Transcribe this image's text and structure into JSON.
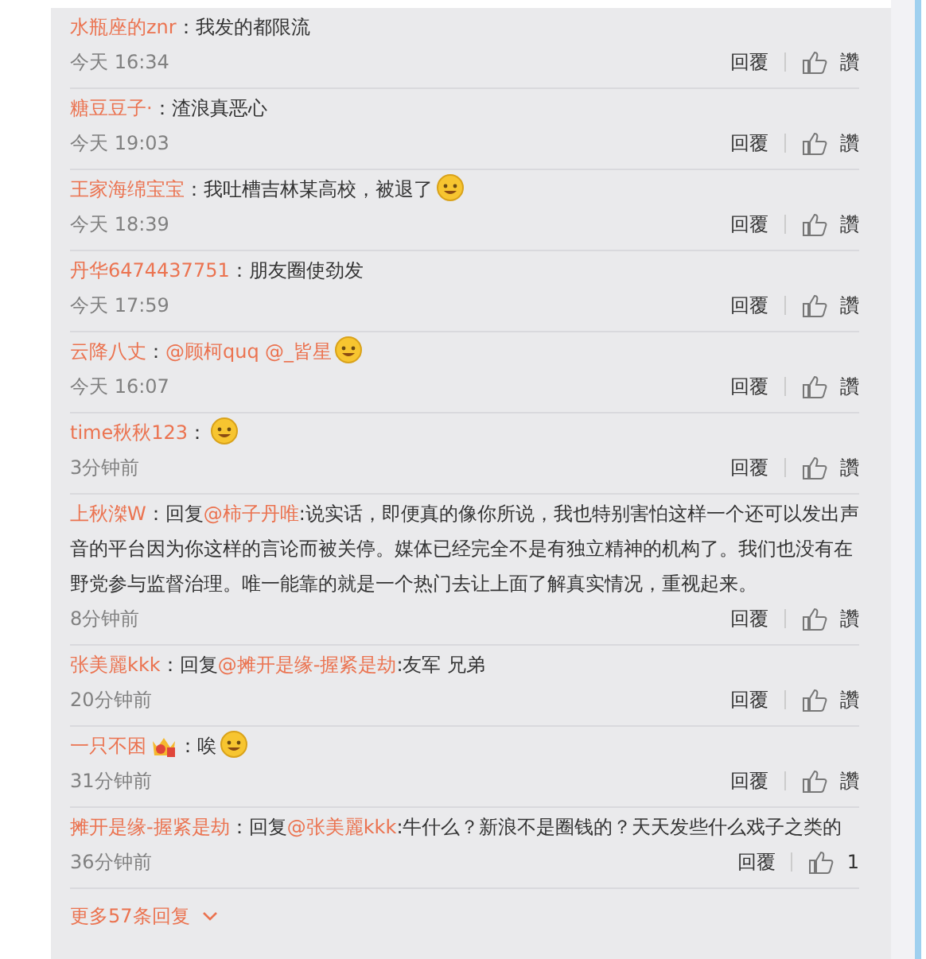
{
  "comments": [
    {
      "user": "水瓶座的znr",
      "colon": "：",
      "content": [
        {
          "kind": "text",
          "text": "我发的都限流"
        }
      ],
      "time": "今天 16:34",
      "reply": "回覆",
      "like": "讚"
    },
    {
      "user": "糖豆豆子·",
      "colon": "：",
      "content": [
        {
          "kind": "text",
          "text": "渣浪真恶心"
        }
      ],
      "time": "今天 19:03",
      "reply": "回覆",
      "like": "讚"
    },
    {
      "user": "王家海绵宝宝",
      "colon": "：",
      "content": [
        {
          "kind": "text",
          "text": "我吐槽吉林某高校，被退了"
        },
        {
          "kind": "emoji"
        }
      ],
      "time": "今天 18:39",
      "reply": "回覆",
      "like": "讚"
    },
    {
      "user": "丹华6474437751",
      "colon": "：",
      "content": [
        {
          "kind": "text",
          "text": "朋友圈使劲发"
        }
      ],
      "time": "今天 17:59",
      "reply": "回覆",
      "like": "讚"
    },
    {
      "user": "云降八丈",
      "colon": "：",
      "content": [
        {
          "kind": "mention",
          "text": "@顾柯quq"
        },
        {
          "kind": "mention",
          "text": "@_皆星"
        },
        {
          "kind": "emoji"
        }
      ],
      "time": "今天 16:07",
      "reply": "回覆",
      "like": "讚"
    },
    {
      "user": "time秋秋123",
      "colon": "：",
      "content": [
        {
          "kind": "emoji"
        }
      ],
      "time": "3分钟前",
      "reply": "回覆",
      "like": "讚"
    },
    {
      "user": "上秋滐W",
      "colon": "：",
      "content": [
        {
          "kind": "text",
          "text": "回复"
        },
        {
          "kind": "mention",
          "text": "@柿子丹唯"
        },
        {
          "kind": "text",
          "text": ":说实话，即便真的像你所说，我也特别害怕这样一个还可以发出声音的平台因为你这样的言论而被关停。媒体已经完全不是有独立精神的机构了。我们也没有在野党参与监督治理。唯一能靠的就是一个热门去让上面了解真实情况，重视起来。"
        }
      ],
      "time": "8分钟前",
      "reply": "回覆",
      "like": "讚"
    },
    {
      "user": "张美麗kkk",
      "colon": "：",
      "content": [
        {
          "kind": "text",
          "text": "回复"
        },
        {
          "kind": "mention",
          "text": "@摊开是缘-握紧是劫"
        },
        {
          "kind": "text",
          "text": ":友军 兄弟"
        }
      ],
      "time": "20分钟前",
      "reply": "回覆",
      "like": "讚"
    },
    {
      "user": "一只不困",
      "badge": true,
      "colon": "：",
      "content": [
        {
          "kind": "text",
          "text": "唉"
        },
        {
          "kind": "emoji"
        }
      ],
      "time": "31分钟前",
      "reply": "回覆",
      "like": "讚"
    },
    {
      "user": "摊开是缘-握紧是劫",
      "colon": "：",
      "content": [
        {
          "kind": "text",
          "text": "回复"
        },
        {
          "kind": "mention",
          "text": "@张美麗kkk"
        },
        {
          "kind": "text",
          "text": ":牛什么？新浪不是圈钱的？天天发些什么戏子之类的"
        }
      ],
      "time": "36分钟前",
      "reply": "回覆",
      "like": "1"
    }
  ],
  "more": "更多57条回复"
}
